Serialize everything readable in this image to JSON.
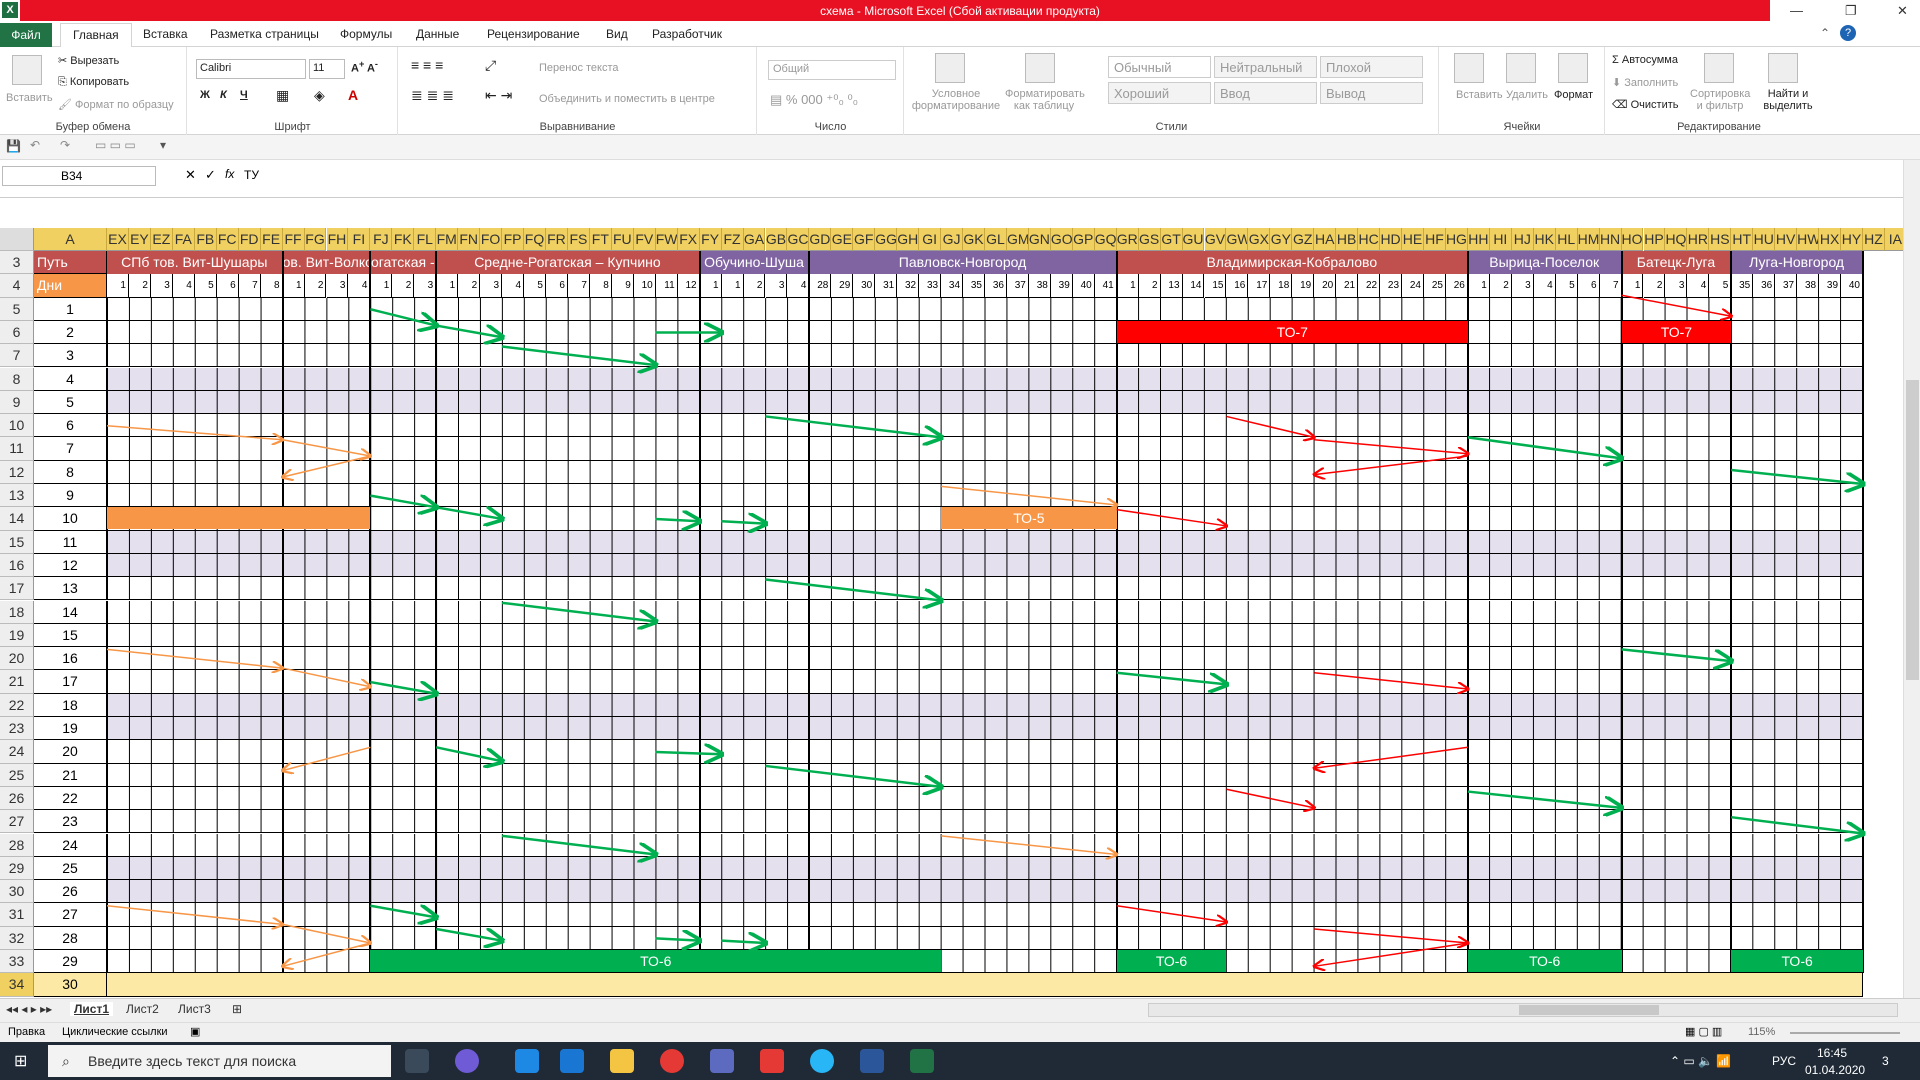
{
  "window": {
    "title": "схема - Microsoft Excel (Сбой активации продукта)",
    "app_glyph": "X",
    "minimize_glyph": "—",
    "restore_glyph": "❐",
    "close_glyph": "✕"
  },
  "tabs": [
    "Файл",
    "Главная",
    "Вставка",
    "Разметка страницы",
    "Формулы",
    "Данные",
    "Рецензирование",
    "Вид",
    "Разработчик"
  ],
  "ribbon": {
    "paste": "Вставить",
    "cut": "Вырезать",
    "copy": "Копировать",
    "format_painter": "Формат по образцу",
    "font_name": "Calibri",
    "font_size": "11",
    "wrap_text": "Перенос текста",
    "merge_center": "Объединить и поместить в центре",
    "number_format": "Общий",
    "cond_format": "Условное форматирование",
    "format_as_table": "Форматировать как таблицу",
    "styles": [
      "Обычный",
      "Нейтральный",
      "Плохой",
      "Хороший",
      "Ввод",
      "Вывод"
    ],
    "insert": "Вставить",
    "delete": "Удалить",
    "format": "Формат",
    "autosum": "Автосумма",
    "fill": "Заполнить",
    "clear": "Очистить",
    "sort_filter": "Сортировка и фильтр",
    "find_select": "Найти и выделить",
    "groups": [
      "Буфер обмена",
      "Шрифт",
      "Выравнивание",
      "Число",
      "Стили",
      "Ячейки",
      "Редактирование"
    ]
  },
  "formula_bar": {
    "name_box": "B34",
    "content": "ТУ",
    "fx": "fx"
  },
  "col_header_a": "A",
  "col_headers": [
    "EX",
    "EY",
    "EZ",
    "FA",
    "FB",
    "FC",
    "FD",
    "FE",
    "FF",
    "FG",
    "FH",
    "FI",
    "FJ",
    "FK",
    "FL",
    "FM",
    "FN",
    "FO",
    "FP",
    "FQ",
    "FR",
    "FS",
    "FT",
    "FU",
    "FV",
    "FW",
    "FX",
    "FY",
    "FZ",
    "GA",
    "GB",
    "GC",
    "GD",
    "GE",
    "GF",
    "GG",
    "GH",
    "GI",
    "GJ",
    "GK",
    "GL",
    "GM",
    "GN",
    "GO",
    "GP",
    "GQ",
    "GR",
    "GS",
    "GT",
    "GU",
    "GV",
    "GW",
    "GX",
    "GY",
    "GZ",
    "HA",
    "HB",
    "HC",
    "HD",
    "HE",
    "HF",
    "HG",
    "HH",
    "HI",
    "HJ",
    "HK",
    "HL",
    "HM",
    "HN",
    "HO",
    "HP",
    "HQ",
    "HR",
    "HS",
    "HT",
    "HU",
    "HV",
    "HW",
    "HX",
    "HY",
    "HZ",
    "IA"
  ],
  "row3_label": "Путь",
  "row4_label": "Дни",
  "sections": [
    {
      "label": "СПб тов. Вит-Шушары",
      "start": 0,
      "span": 8,
      "color": "#c0504d"
    },
    {
      "label": "ов. Вит-Волко",
      "start": 8,
      "span": 4,
      "color": "#c0504d"
    },
    {
      "label": "огатская -",
      "start": 12,
      "span": 3,
      "color": "#c0504d"
    },
    {
      "label": "Средне-Рогатская – Купчино",
      "start": 15,
      "span": 12,
      "color": "#c0504d"
    },
    {
      "label": "Обучино-Шуша",
      "start": 27,
      "span": 5,
      "color": "#8064a2"
    },
    {
      "label": "Павловск-Новгород",
      "start": 32,
      "span": 14,
      "color": "#8064a2"
    },
    {
      "label": "Владимирская-Кобралово",
      "start": 46,
      "span": 16,
      "color": "#c0504d"
    },
    {
      "label": "Вырица-Поселок",
      "start": 62,
      "span": 7,
      "color": "#8064a2"
    },
    {
      "label": "Батецк-Луга",
      "start": 69,
      "span": 5,
      "color": "#c0504d"
    },
    {
      "label": "Луга-Новгород",
      "start": 74,
      "span": 6,
      "color": "#8064a2"
    }
  ],
  "day_numbers": [
    "1",
    "2",
    "3",
    "4",
    "5",
    "6",
    "7",
    "8",
    "1",
    "2",
    "3",
    "4",
    "1",
    "2",
    "3",
    "1",
    "2",
    "3",
    "4",
    "5",
    "6",
    "7",
    "8",
    "9",
    "10",
    "11",
    "12",
    "1",
    "1",
    "2",
    "3",
    "4",
    "28",
    "29",
    "30",
    "31",
    "32",
    "33",
    "34",
    "35",
    "36",
    "37",
    "38",
    "39",
    "40",
    "41",
    "1",
    "2",
    "13",
    "14",
    "15",
    "16",
    "17",
    "18",
    "19",
    "20",
    "21",
    "22",
    "23",
    "24",
    "25",
    "26",
    "1",
    "2",
    "3",
    "4",
    "5",
    "6",
    "7",
    "1",
    "2",
    "3",
    "4",
    "5",
    "35",
    "36",
    "37",
    "38",
    "39",
    "40"
  ],
  "rows": [
    {
      "num": "5",
      "day": "1"
    },
    {
      "num": "6",
      "day": "2"
    },
    {
      "num": "7",
      "day": "3"
    },
    {
      "num": "8",
      "day": "4"
    },
    {
      "num": "9",
      "day": "5"
    },
    {
      "num": "10",
      "day": "6"
    },
    {
      "num": "11",
      "day": "7"
    },
    {
      "num": "12",
      "day": "8"
    },
    {
      "num": "13",
      "day": "9"
    },
    {
      "num": "14",
      "day": "10"
    },
    {
      "num": "15",
      "day": "11"
    },
    {
      "num": "16",
      "day": "12"
    },
    {
      "num": "17",
      "day": "13"
    },
    {
      "num": "18",
      "day": "14"
    },
    {
      "num": "19",
      "day": "15"
    },
    {
      "num": "20",
      "day": "16"
    },
    {
      "num": "21",
      "day": "17"
    },
    {
      "num": "22",
      "day": "18"
    },
    {
      "num": "23",
      "day": "19"
    },
    {
      "num": "24",
      "day": "20"
    },
    {
      "num": "25",
      "day": "21"
    },
    {
      "num": "26",
      "day": "22"
    },
    {
      "num": "27",
      "day": "23"
    },
    {
      "num": "28",
      "day": "24"
    },
    {
      "num": "29",
      "day": "25"
    },
    {
      "num": "30",
      "day": "26"
    },
    {
      "num": "31",
      "day": "27"
    },
    {
      "num": "32",
      "day": "28"
    },
    {
      "num": "33",
      "day": "29"
    },
    {
      "num": "34",
      "day": "30"
    }
  ],
  "shaded_days": [
    "4",
    "5",
    "11",
    "12",
    "18",
    "19",
    "25",
    "26"
  ],
  "bars": [
    {
      "label": "ТО-7",
      "row": 1,
      "c0": 46,
      "c1": 62,
      "color": "#ff0000"
    },
    {
      "label": "ТО-7",
      "row": 1,
      "c0": 69,
      "c1": 74,
      "color": "#ff0000"
    },
    {
      "label": "",
      "row": 9,
      "c0": 0,
      "c1": 12,
      "color": "#f79646"
    },
    {
      "label": "ТО-5",
      "row": 9,
      "c0": 38,
      "c1": 46,
      "color": "#f79646"
    },
    {
      "label": "ТО-6",
      "row": 28,
      "c0": 12,
      "c1": 38,
      "color": "#00b050"
    },
    {
      "label": "ТО-6",
      "row": 28,
      "c0": 46,
      "c1": 51,
      "color": "#00b050"
    },
    {
      "label": "ТО-6",
      "row": 28,
      "c0": 62,
      "c1": 69,
      "color": "#00b050"
    },
    {
      "label": "ТО-6",
      "row": 28,
      "c0": 74,
      "c1": 80,
      "color": "#00b050"
    }
  ],
  "arrows": [
    {
      "c": "#00b050",
      "r0": 0,
      "c0": 12,
      "r1": 0.7,
      "c1": 15
    },
    {
      "c": "#00b050",
      "r0": 0.7,
      "c0": 15,
      "r1": 1.2,
      "c1": 18
    },
    {
      "c": "#00b050",
      "r0": 1,
      "c0": 25,
      "r1": 1,
      "c1": 28
    },
    {
      "c": "#00b050",
      "r0": 1.6,
      "c0": 18,
      "r1": 2.4,
      "c1": 25
    },
    {
      "c": "#f79646",
      "r0": 5,
      "c0": 0,
      "r1": 5.6,
      "c1": 8
    },
    {
      "c": "#f79646",
      "r0": 5.6,
      "c0": 8,
      "r1": 6.3,
      "c1": 12
    },
    {
      "c": "#f79646",
      "r0": 6.3,
      "c0": 12,
      "r1": 7.2,
      "c1": 8
    },
    {
      "c": "#00b050",
      "r0": 4.6,
      "c0": 30,
      "r1": 5.5,
      "c1": 38
    },
    {
      "c": "#00b050",
      "r0": 8,
      "c0": 12,
      "r1": 8.5,
      "c1": 15
    },
    {
      "c": "#00b050",
      "r0": 8.5,
      "c0": 15,
      "r1": 9,
      "c1": 18
    },
    {
      "c": "#00b050",
      "r0": 9,
      "c0": 25,
      "r1": 9.1,
      "c1": 27
    },
    {
      "c": "#00b050",
      "r0": 9.1,
      "c0": 28,
      "r1": 9.2,
      "c1": 30
    },
    {
      "c": "#f79646",
      "r0": 7.6,
      "c0": 38,
      "r1": 8.4,
      "c1": 46
    },
    {
      "c": "#ff0000",
      "r0": 8.6,
      "c0": 46,
      "r1": 9.3,
      "c1": 51
    },
    {
      "c": "#ff0000",
      "r0": 4.6,
      "c0": 51,
      "r1": 5.5,
      "c1": 55
    },
    {
      "c": "#ff0000",
      "r0": 5.6,
      "c0": 55,
      "r1": 6.2,
      "c1": 62
    },
    {
      "c": "#ff0000",
      "r0": 6.3,
      "c0": 62,
      "r1": 7.1,
      "c1": 55
    },
    {
      "c": "#00b050",
      "r0": 5.5,
      "c0": 62,
      "r1": 6.4,
      "c1": 69
    },
    {
      "c": "#ff0000",
      "r0": -0.6,
      "c0": 69,
      "r1": 0.3,
      "c1": 74
    },
    {
      "c": "#00b050",
      "r0": 6.9,
      "c0": 74,
      "r1": 7.5,
      "c1": 80
    },
    {
      "c": "#00b050",
      "r0": 12.6,
      "c0": 18,
      "r1": 13.4,
      "c1": 25
    },
    {
      "c": "#00b050",
      "r0": 11.6,
      "c0": 30,
      "r1": 12.5,
      "c1": 38
    },
    {
      "c": "#00b050",
      "r0": 14.6,
      "c0": 69,
      "r1": 15.1,
      "c1": 74
    },
    {
      "c": "#f79646",
      "r0": 14.6,
      "c0": 0,
      "r1": 15.4,
      "c1": 8
    },
    {
      "c": "#f79646",
      "r0": 15.4,
      "c0": 8,
      "r1": 16.2,
      "c1": 12
    },
    {
      "c": "#00b050",
      "r0": 15.6,
      "c0": 46,
      "r1": 16.1,
      "c1": 51
    },
    {
      "c": "#ff0000",
      "r0": 15.6,
      "c0": 55,
      "r1": 16.3,
      "c1": 62
    },
    {
      "c": "#00b050",
      "r0": 16,
      "c0": 12,
      "r1": 16.5,
      "c1": 15
    },
    {
      "c": "#f79646",
      "r0": 18.8,
      "c0": 12,
      "r1": 19.8,
      "c1": 8
    },
    {
      "c": "#00b050",
      "r0": 18.8,
      "c0": 15,
      "r1": 19.4,
      "c1": 18
    },
    {
      "c": "#00b050",
      "r0": 19,
      "c0": 25,
      "r1": 19.1,
      "c1": 28
    },
    {
      "c": "#ff0000",
      "r0": 18.8,
      "c0": 62,
      "r1": 19.7,
      "c1": 55
    },
    {
      "c": "#00b050",
      "r0": 19.6,
      "c0": 30,
      "r1": 20.5,
      "c1": 38
    },
    {
      "c": "#ff0000",
      "r0": 20.6,
      "c0": 51,
      "r1": 21.4,
      "c1": 55
    },
    {
      "c": "#00b050",
      "r0": 20.7,
      "c0": 62,
      "r1": 21.4,
      "c1": 69
    },
    {
      "c": "#00b050",
      "r0": 21.8,
      "c0": 74,
      "r1": 22.5,
      "c1": 80
    },
    {
      "c": "#f79646",
      "r0": 22.6,
      "c0": 38,
      "r1": 23.4,
      "c1": 46
    },
    {
      "c": "#00b050",
      "r0": 22.6,
      "c0": 18,
      "r1": 23.4,
      "c1": 25
    },
    {
      "c": "#f79646",
      "r0": 25.6,
      "c0": 0,
      "r1": 26.4,
      "c1": 8
    },
    {
      "c": "#f79646",
      "r0": 26.4,
      "c0": 8,
      "r1": 27.2,
      "c1": 12
    },
    {
      "c": "#f79646",
      "r0": 27.2,
      "c0": 12,
      "r1": 28.2,
      "c1": 8
    },
    {
      "c": "#00b050",
      "r0": 25.6,
      "c0": 12,
      "r1": 26.1,
      "c1": 15
    },
    {
      "c": "#00b050",
      "r0": 26.6,
      "c0": 15,
      "r1": 27.1,
      "c1": 18
    },
    {
      "c": "#00b050",
      "r0": 27,
      "c0": 25,
      "r1": 27.1,
      "c1": 27
    },
    {
      "c": "#00b050",
      "r0": 27.1,
      "c0": 28,
      "r1": 27.2,
      "c1": 30
    },
    {
      "c": "#ff0000",
      "r0": 25.6,
      "c0": 46,
      "r1": 26.3,
      "c1": 51
    },
    {
      "c": "#ff0000",
      "r0": 26.6,
      "c0": 55,
      "r1": 27.2,
      "c1": 62
    },
    {
      "c": "#ff0000",
      "r0": 27.2,
      "c0": 62,
      "r1": 28.2,
      "c1": 55
    }
  ],
  "sheets": [
    "Лист1",
    "Лист2",
    "Лист3"
  ],
  "status": {
    "mode": "Правка",
    "note": "Циклические ссылки",
    "zoom": "115%"
  },
  "taskbar": {
    "search_placeholder": "Введите здесь текст для поиска",
    "lang": "РУС",
    "time": "16:45",
    "date": "01.04.2020",
    "notif_count": "3"
  }
}
